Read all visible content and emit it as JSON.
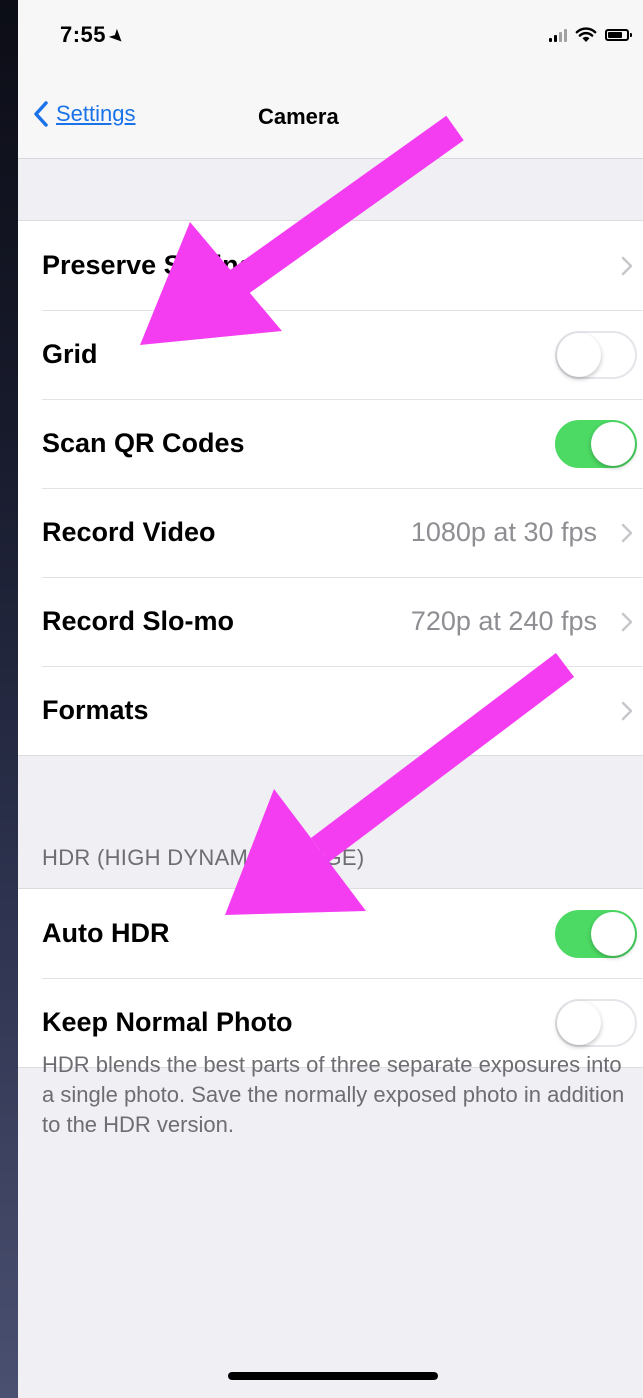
{
  "status_bar": {
    "time": "7:55",
    "location_icon": "location-arrow-icon",
    "signal_icon": "cellular-signal-icon",
    "wifi_icon": "wifi-icon",
    "battery_icon": "battery-icon"
  },
  "nav": {
    "back_label": "Settings",
    "title": "Camera"
  },
  "group1": {
    "preserve_settings": "Preserve Settings",
    "grid": "Grid",
    "scan_qr_codes": "Scan QR Codes",
    "record_video": "Record Video",
    "record_video_value": "1080p at 30 fps",
    "record_slomo": "Record Slo-mo",
    "record_slomo_value": "720p at 240 fps",
    "formats": "Formats"
  },
  "hdr": {
    "header": "HDR (HIGH DYNAMIC RANGE)",
    "auto_hdr": "Auto HDR",
    "keep_normal_photo": "Keep Normal Photo",
    "footer": "HDR blends the best parts of three separate exposures into a single photo. Save the normally exposed photo in addition to the HDR version."
  },
  "toggles": {
    "grid": false,
    "scan_qr_codes": true,
    "auto_hdr": true,
    "keep_normal_photo": false
  },
  "colors": {
    "toggle_on": "#4cd964",
    "link": "#1a73e8",
    "annotation_arrow": "#f43df0"
  }
}
